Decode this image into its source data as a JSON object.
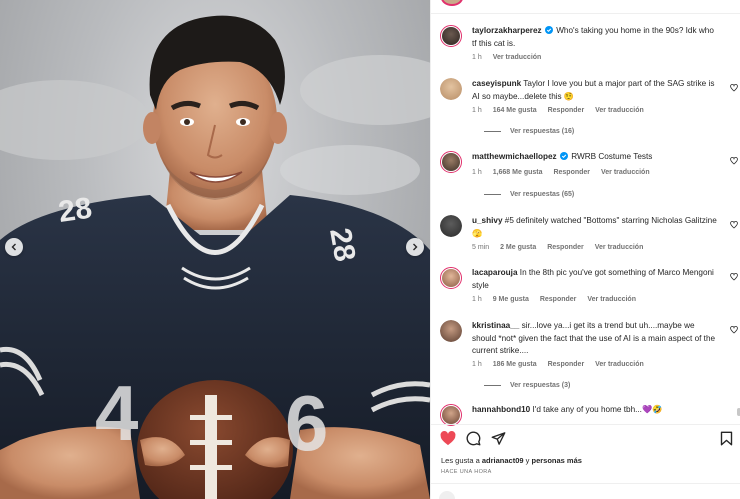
{
  "post": {
    "caption": {
      "username": "taylorzakharperez",
      "text": "Who's taking you home in the 90s? Idk who tf this cat is.",
      "time": "1 h",
      "translate": "Ver traducción"
    }
  },
  "comments": [
    {
      "username": "caseyispunk",
      "text": "Taylor I love you but a major part of the SAG strike is AI so maybe...delete this 🤨",
      "time": "1 h",
      "likes": "164 Me gusta",
      "reply": "Responder",
      "translate": "Ver traducción",
      "view_replies": "Ver respuestas (16)"
    },
    {
      "username": "matthewmichaellopez",
      "text": "RWRB Costume Tests",
      "time": "1 h",
      "likes": "1,668 Me gusta",
      "reply": "Responder",
      "translate": "Ver traducción",
      "view_replies": "Ver respuestas (65)"
    },
    {
      "username": "u_shivy",
      "text": "#5 definitely watched \"Bottoms\" starring Nicholas Galitzine 🫣",
      "time": "5 min",
      "likes": "2 Me gusta",
      "reply": "Responder",
      "translate": "Ver traducción"
    },
    {
      "username": "lacaparouja",
      "text": "In the 8th pic you've got something of Marco Mengoni style",
      "time": "1 h",
      "likes": "9 Me gusta",
      "reply": "Responder",
      "translate": "Ver traducción"
    },
    {
      "username": "kkristinaa__",
      "text": "sir...love ya...i get its a trend but uh....maybe we should *not* given the fact that the use of AI is a main aspect of the current strike....",
      "time": "1 h",
      "likes": "186 Me gusta",
      "reply": "Responder",
      "translate": "Ver traducción",
      "view_replies": "Ver respuestas (3)"
    },
    {
      "username": "hannahbond10",
      "text": "I'd take any of you home tbh...💜🤣"
    }
  ],
  "likes_line": {
    "prefix": "Les gusta a ",
    "user": "adrianact09",
    "middle": " y ",
    "rest": "personas más"
  },
  "posted_ago": "HACE UNA HORA",
  "photo": {
    "jersey_number": "28"
  },
  "icons": [
    "heart-filled-icon",
    "comment-icon",
    "share-icon",
    "bookmark-icon",
    "verified-icon",
    "heart-outline-icon",
    "chevron-left-icon",
    "chevron-right-icon"
  ],
  "colors": {
    "like_red": "#ed4956",
    "verified_blue": "#0095f6",
    "story_ring": "#e1306c",
    "muted_text": "#737373"
  }
}
